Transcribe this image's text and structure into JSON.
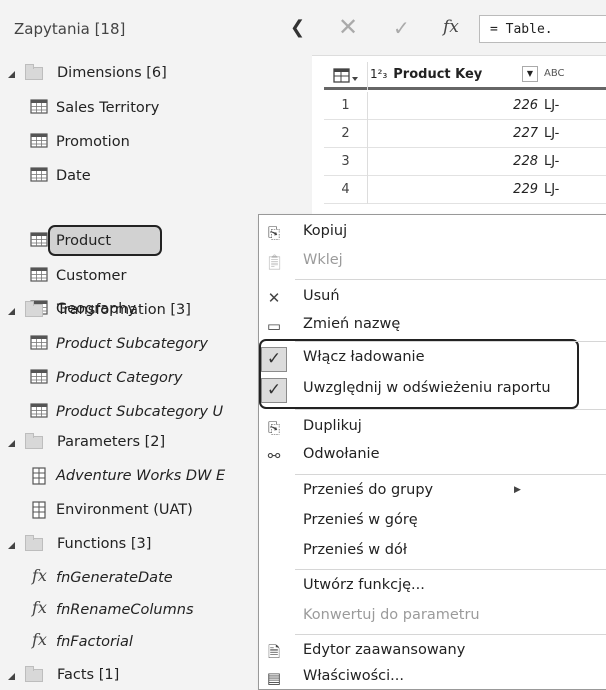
{
  "pane": {
    "title": "Zapytania [18]",
    "groups": [
      {
        "label": "Dimensions [6]",
        "items": [
          {
            "label": "Sales Territory",
            "italic": false,
            "icon": "table-icon"
          },
          {
            "label": "Promotion",
            "italic": false,
            "icon": "table-icon"
          },
          {
            "label": "Date",
            "italic": false,
            "icon": "table-icon"
          },
          {
            "label": "Product",
            "italic": false,
            "icon": "table-icon",
            "selected": true
          },
          {
            "label": "Customer",
            "italic": false,
            "icon": "table-icon"
          },
          {
            "label": "Geography",
            "italic": false,
            "icon": "table-icon"
          }
        ]
      },
      {
        "label": "Transformation [3]",
        "items": [
          {
            "label": "Product Subcategory",
            "italic": true,
            "icon": "table-icon"
          },
          {
            "label": "Product Category",
            "italic": true,
            "icon": "table-icon"
          },
          {
            "label": "Product Subcategory U",
            "italic": true,
            "icon": "table-icon"
          }
        ]
      },
      {
        "label": "Parameters [2]",
        "items": [
          {
            "label": "Adventure Works DW E",
            "italic": true,
            "icon": "parameter-icon"
          },
          {
            "label": "Environment (UAT)",
            "italic": false,
            "icon": "parameter-icon"
          }
        ]
      },
      {
        "label": "Functions [3]",
        "items": [
          {
            "label": "fnGenerateDate",
            "italic": true,
            "icon": "function-icon"
          },
          {
            "label": "fnRenameColumns",
            "italic": true,
            "icon": "function-icon"
          },
          {
            "label": "fnFactorial",
            "italic": true,
            "icon": "function-icon"
          }
        ]
      },
      {
        "label": "Facts [1]",
        "items": []
      }
    ]
  },
  "formula_bar": {
    "cancel_icon": "close-icon",
    "commit_icon": "check-icon",
    "fx_symbol": "fx",
    "formula": "= Table."
  },
  "grid": {
    "column_type": "1²₃",
    "column_name": "Product Key",
    "column2_type": "ABC",
    "rows": [
      {
        "n": "1",
        "value": "226",
        "col2": "LJ-"
      },
      {
        "n": "2",
        "value": "227",
        "col2": "LJ-"
      },
      {
        "n": "3",
        "value": "228",
        "col2": "LJ-"
      },
      {
        "n": "4",
        "value": "229",
        "col2": "LJ-"
      }
    ]
  },
  "menu": {
    "items": [
      {
        "label": "Kopiuj",
        "icon": "copy-icon",
        "disabled": false
      },
      {
        "label": "Wklej",
        "icon": "paste-icon",
        "disabled": true
      },
      {
        "label": "Usuń",
        "icon": "delete-icon",
        "disabled": false
      },
      {
        "label": "Zmień nazwę",
        "icon": "rename-icon",
        "disabled": false
      },
      {
        "label": "Włącz ładowanie",
        "icon": "checkmark-icon",
        "checked": true
      },
      {
        "label": "Uwzględnij w odświeżeniu raportu",
        "icon": "checkmark-icon",
        "checked": true
      },
      {
        "label": "Duplikuj",
        "icon": "duplicate-icon",
        "disabled": false
      },
      {
        "label": "Odwołanie",
        "icon": "reference-icon",
        "disabled": false
      },
      {
        "label": "Przenieś do grupy",
        "icon": "",
        "submenu": true
      },
      {
        "label": "Przenieś w górę",
        "icon": ""
      },
      {
        "label": "Przenieś w dół",
        "icon": ""
      },
      {
        "label": "Utwórz funkcję...",
        "icon": ""
      },
      {
        "label": "Konwertuj do parametru",
        "icon": "",
        "disabled": true
      },
      {
        "label": "Edytor zaawansowany",
        "icon": "advanced-editor-icon"
      },
      {
        "label": "Właściwości...",
        "icon": "properties-icon"
      }
    ]
  }
}
